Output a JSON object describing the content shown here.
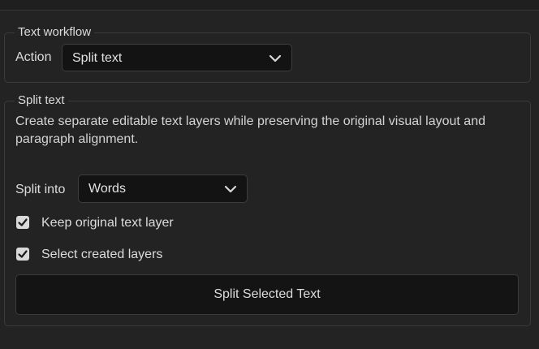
{
  "workflow": {
    "legend": "Text workflow",
    "action_label": "Action",
    "action_value": "Split text",
    "action_icon": "chevron-down-icon"
  },
  "split": {
    "legend": "Split text",
    "description": "Create separate editable text layers while preserving the original visual layout and paragraph alignment.",
    "split_into_label": "Split into",
    "split_into_value": "Words",
    "split_into_icon": "chevron-down-icon",
    "keep_original": {
      "label": "Keep original text layer",
      "checked": true
    },
    "select_created": {
      "label": "Select created layers",
      "checked": true
    },
    "button_label": "Split Selected Text"
  },
  "colors": {
    "background": "#232323",
    "control_bg": "#131313",
    "border": "#3b3b3b",
    "text": "#dcdcdc",
    "checkbox": "#d9d9d9"
  }
}
